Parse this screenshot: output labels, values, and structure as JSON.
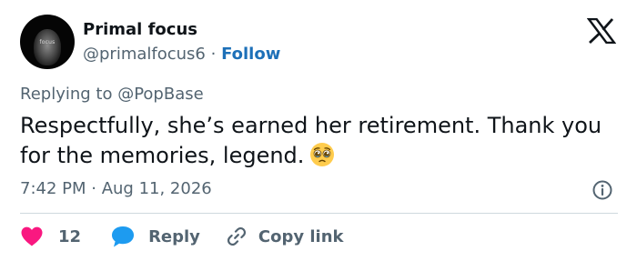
{
  "user": {
    "display_name": "Primal focus",
    "handle": "@primalfocus6",
    "separator": " · ",
    "follow_label": "Follow",
    "avatar_text": "focus"
  },
  "reply": {
    "prefix": "Replying to ",
    "target": "@PopBase"
  },
  "tweet": {
    "text": "Respectfully, she’s earned her retirement. Thank you for the memories, legend.",
    "emoji": "pleading-face-emoji"
  },
  "meta": {
    "time": "7:42 PM",
    "separator": " · ",
    "date": "Aug 11, 2026"
  },
  "actions": {
    "like_count": "12",
    "reply_label": "Reply",
    "copy_link_label": "Copy link"
  },
  "colors": {
    "text": "#0f1419",
    "muted": "#536471",
    "follow": "#1d70b8",
    "like": "#f91880",
    "reply": "#1d9bf0",
    "divider": "#cfd9de"
  }
}
